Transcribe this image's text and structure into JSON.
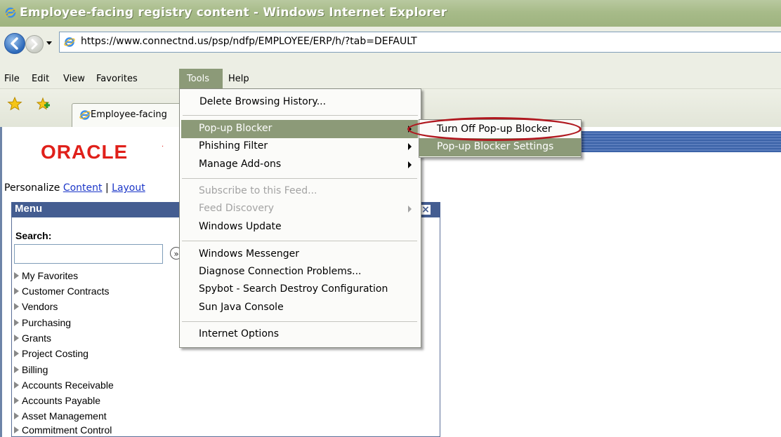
{
  "window": {
    "title": "Employee-facing registry content - Windows Internet Explorer"
  },
  "address": {
    "url": "https://www.connectnd.us/psp/ndfp/EMPLOYEE/ERP/h/?tab=DEFAULT"
  },
  "menubar": {
    "items": [
      "File",
      "Edit",
      "View",
      "Favorites",
      "Tools",
      "Help"
    ]
  },
  "tab": {
    "label": "Employee-facing"
  },
  "tools_menu": {
    "items": [
      {
        "label": "Delete Browsing History...",
        "disabled": false
      },
      {
        "label": "Pop-up Blocker",
        "disabled": false,
        "submenu": true,
        "highlighted": true
      },
      {
        "label": "Phishing Filter",
        "disabled": false,
        "submenu": true
      },
      {
        "label": "Manage Add-ons",
        "disabled": false,
        "submenu": true
      },
      {
        "label": "Subscribe to this Feed...",
        "disabled": true
      },
      {
        "label": "Feed Discovery",
        "disabled": true,
        "submenu": true
      },
      {
        "label": "Windows Update",
        "disabled": false
      },
      {
        "label": "Windows Messenger",
        "disabled": false
      },
      {
        "label": "Diagnose Connection Problems...",
        "disabled": false
      },
      {
        "label": "Spybot - Search  Destroy Configuration",
        "disabled": false
      },
      {
        "label": "Sun Java Console",
        "disabled": false
      },
      {
        "label": "Internet Options",
        "disabled": false
      }
    ]
  },
  "popup_submenu": {
    "turn_off": "Turn Off Pop-up Blocker",
    "settings": "Pop-up Blocker Settings"
  },
  "page": {
    "logo": "ORACLE",
    "personalize_prefix": "Personalize ",
    "content_link": "Content",
    "separator": " | ",
    "layout_link": "Layout",
    "menu_title": "Menu",
    "search_label": "Search:",
    "nav_items": [
      "My Favorites",
      "Customer Contracts",
      "Vendors",
      "Purchasing",
      "Grants",
      "Project Costing",
      "Billing",
      "Accounts Receivable",
      "Accounts Payable",
      "Asset Management",
      "Commitment Control"
    ]
  },
  "colors": {
    "menu_highlight": "#8c9a78",
    "callout_ring": "#b0181f",
    "oracle_red": "#e0201a",
    "pagelet_header": "#445d91"
  }
}
